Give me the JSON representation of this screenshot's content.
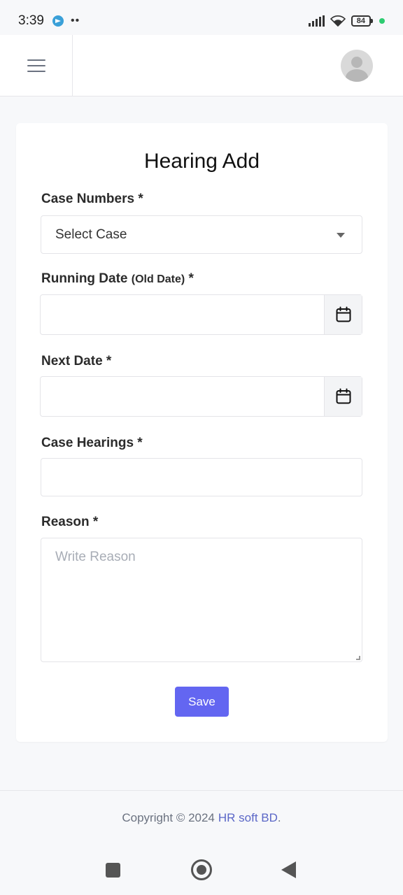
{
  "status_bar": {
    "time": "3:39",
    "dots": "••",
    "battery": "84"
  },
  "form": {
    "title": "Hearing Add",
    "case_numbers": {
      "label": "Case Numbers",
      "required": " *",
      "select_value": "Select Case"
    },
    "running_date": {
      "label": "Running Date",
      "label_note": "(Old Date)",
      "required": " *"
    },
    "next_date": {
      "label": "Next Date",
      "required": " *"
    },
    "case_hearings": {
      "label": "Case Hearings",
      "required": " *"
    },
    "reason": {
      "label": "Reason",
      "required": " *",
      "placeholder": "Write Reason"
    },
    "save_label": "Save"
  },
  "footer": {
    "copyright": "Copyright © 2024",
    "brand": "HR soft BD",
    "period": "."
  },
  "colors": {
    "accent": "#6366f1",
    "brand_link": "#5b67c7"
  }
}
